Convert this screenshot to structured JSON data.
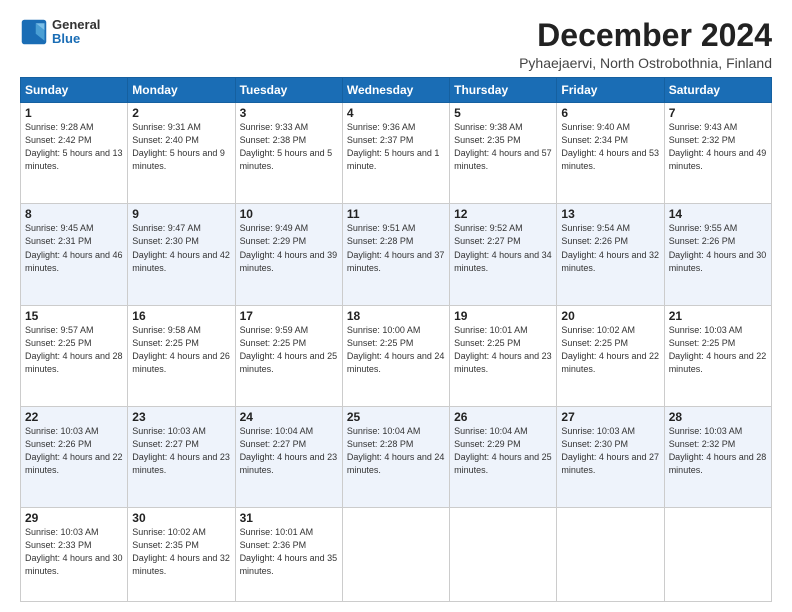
{
  "logo": {
    "general": "General",
    "blue": "Blue"
  },
  "title": "December 2024",
  "subtitle": "Pyhaejaervi, North Ostrobothnia, Finland",
  "weekdays": [
    "Sunday",
    "Monday",
    "Tuesday",
    "Wednesday",
    "Thursday",
    "Friday",
    "Saturday"
  ],
  "weeks": [
    [
      {
        "day": "1",
        "sunrise": "9:28 AM",
        "sunset": "2:42 PM",
        "daylight": "5 hours and 13 minutes."
      },
      {
        "day": "2",
        "sunrise": "9:31 AM",
        "sunset": "2:40 PM",
        "daylight": "5 hours and 9 minutes."
      },
      {
        "day": "3",
        "sunrise": "9:33 AM",
        "sunset": "2:38 PM",
        "daylight": "5 hours and 5 minutes."
      },
      {
        "day": "4",
        "sunrise": "9:36 AM",
        "sunset": "2:37 PM",
        "daylight": "5 hours and 1 minute."
      },
      {
        "day": "5",
        "sunrise": "9:38 AM",
        "sunset": "2:35 PM",
        "daylight": "4 hours and 57 minutes."
      },
      {
        "day": "6",
        "sunrise": "9:40 AM",
        "sunset": "2:34 PM",
        "daylight": "4 hours and 53 minutes."
      },
      {
        "day": "7",
        "sunrise": "9:43 AM",
        "sunset": "2:32 PM",
        "daylight": "4 hours and 49 minutes."
      }
    ],
    [
      {
        "day": "8",
        "sunrise": "9:45 AM",
        "sunset": "2:31 PM",
        "daylight": "4 hours and 46 minutes."
      },
      {
        "day": "9",
        "sunrise": "9:47 AM",
        "sunset": "2:30 PM",
        "daylight": "4 hours and 42 minutes."
      },
      {
        "day": "10",
        "sunrise": "9:49 AM",
        "sunset": "2:29 PM",
        "daylight": "4 hours and 39 minutes."
      },
      {
        "day": "11",
        "sunrise": "9:51 AM",
        "sunset": "2:28 PM",
        "daylight": "4 hours and 37 minutes."
      },
      {
        "day": "12",
        "sunrise": "9:52 AM",
        "sunset": "2:27 PM",
        "daylight": "4 hours and 34 minutes."
      },
      {
        "day": "13",
        "sunrise": "9:54 AM",
        "sunset": "2:26 PM",
        "daylight": "4 hours and 32 minutes."
      },
      {
        "day": "14",
        "sunrise": "9:55 AM",
        "sunset": "2:26 PM",
        "daylight": "4 hours and 30 minutes."
      }
    ],
    [
      {
        "day": "15",
        "sunrise": "9:57 AM",
        "sunset": "2:25 PM",
        "daylight": "4 hours and 28 minutes."
      },
      {
        "day": "16",
        "sunrise": "9:58 AM",
        "sunset": "2:25 PM",
        "daylight": "4 hours and 26 minutes."
      },
      {
        "day": "17",
        "sunrise": "9:59 AM",
        "sunset": "2:25 PM",
        "daylight": "4 hours and 25 minutes."
      },
      {
        "day": "18",
        "sunrise": "10:00 AM",
        "sunset": "2:25 PM",
        "daylight": "4 hours and 24 minutes."
      },
      {
        "day": "19",
        "sunrise": "10:01 AM",
        "sunset": "2:25 PM",
        "daylight": "4 hours and 23 minutes."
      },
      {
        "day": "20",
        "sunrise": "10:02 AM",
        "sunset": "2:25 PM",
        "daylight": "4 hours and 22 minutes."
      },
      {
        "day": "21",
        "sunrise": "10:03 AM",
        "sunset": "2:25 PM",
        "daylight": "4 hours and 22 minutes."
      }
    ],
    [
      {
        "day": "22",
        "sunrise": "10:03 AM",
        "sunset": "2:26 PM",
        "daylight": "4 hours and 22 minutes."
      },
      {
        "day": "23",
        "sunrise": "10:03 AM",
        "sunset": "2:27 PM",
        "daylight": "4 hours and 23 minutes."
      },
      {
        "day": "24",
        "sunrise": "10:04 AM",
        "sunset": "2:27 PM",
        "daylight": "4 hours and 23 minutes."
      },
      {
        "day": "25",
        "sunrise": "10:04 AM",
        "sunset": "2:28 PM",
        "daylight": "4 hours and 24 minutes."
      },
      {
        "day": "26",
        "sunrise": "10:04 AM",
        "sunset": "2:29 PM",
        "daylight": "4 hours and 25 minutes."
      },
      {
        "day": "27",
        "sunrise": "10:03 AM",
        "sunset": "2:30 PM",
        "daylight": "4 hours and 27 minutes."
      },
      {
        "day": "28",
        "sunrise": "10:03 AM",
        "sunset": "2:32 PM",
        "daylight": "4 hours and 28 minutes."
      }
    ],
    [
      {
        "day": "29",
        "sunrise": "10:03 AM",
        "sunset": "2:33 PM",
        "daylight": "4 hours and 30 minutes."
      },
      {
        "day": "30",
        "sunrise": "10:02 AM",
        "sunset": "2:35 PM",
        "daylight": "4 hours and 32 minutes."
      },
      {
        "day": "31",
        "sunrise": "10:01 AM",
        "sunset": "2:36 PM",
        "daylight": "4 hours and 35 minutes."
      },
      null,
      null,
      null,
      null
    ]
  ]
}
